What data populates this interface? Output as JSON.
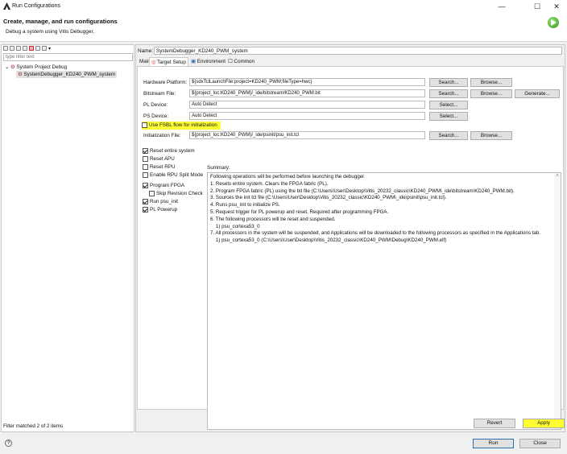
{
  "window": {
    "title": "Run Configurations",
    "minimize": "—",
    "maximize": "☐",
    "close": "✕"
  },
  "header": {
    "title": "Create, manage, and run configurations",
    "subtitle": "Debug a system using Vitis Debugger."
  },
  "left": {
    "filter_placeholder": "type filter text",
    "tree": [
      {
        "label": "System Project Debug"
      },
      {
        "label": "SystemDebugger_KD240_PWM_system"
      }
    ],
    "status": "Filter matched 2 of 2 items"
  },
  "right": {
    "name_label": "Name:",
    "name_value": "SystemDebugger_KD240_PWM_system",
    "tabs": [
      {
        "label": "Main"
      },
      {
        "label": "Target Setup"
      },
      {
        "label": "Environment"
      },
      {
        "label": "Common"
      }
    ],
    "fields": {
      "hardware_platform": {
        "label": "Hardware Platform:",
        "value": "${sdxTclLaunchFile:project=KD240_PWM;fileType=hwc}"
      },
      "bitstream": {
        "label": "Bitstream File:",
        "value": "${project_loc:KD240_PWM}/_ide/bitstream/KD240_PWM.bit"
      },
      "pl_device": {
        "label": "PL Device:",
        "value": "Auto Detect"
      },
      "ps_device": {
        "label": "PS Device:",
        "value": "Auto Detect"
      },
      "use_fsbl": {
        "label": "Use FSBL flow for initialization"
      },
      "init_file": {
        "label": "Initialization File:",
        "value": "${project_loc:KD240_PWM}/_ide/psinit/psu_init.tcl"
      }
    },
    "buttons": {
      "search": "Search...",
      "browse": "Browse...",
      "generate": "Generate...",
      "select": "Select..."
    },
    "options": [
      {
        "label": "Reset entire system",
        "checked": true
      },
      {
        "label": "Reset APU",
        "checked": false
      },
      {
        "label": "Reset RPU",
        "checked": false
      },
      {
        "label": "Enable RPU Split Mode",
        "checked": false
      },
      {
        "label": "Program FPGA",
        "checked": true
      },
      {
        "label": "Skip Revision Check",
        "checked": false
      },
      {
        "label": "Run psu_init",
        "checked": true
      },
      {
        "label": "PL Powerup",
        "checked": true
      }
    ],
    "summary_label": "Summary:",
    "summary_lines": [
      "Following operations will be performed before launching the debugger.",
      "1. Resets entire system. Clears the FPGA fabric (PL).",
      "2. Program FPGA fabric (PL) using the bit file (C:\\Users\\User\\Desktop\\Vitis_20232_classic\\KD240_PWM\\_ide\\bitstream\\KD240_PWM.bit).",
      "3. Sources the init tcl file (C:\\Users\\User\\Desktop\\Vitis_20232_classic\\KD240_PWM\\_ide\\psinit\\psu_init.tcl).",
      "4. Runs psu_init to initialize PS.",
      "5. Request trigger for PL powerup and reset. Required after programming FPGA.",
      "6. The following processors will be reset and suspended.",
      "    1) psu_cortexa53_0",
      "7. All processors in the system will be suspended, and Applications will be downloaded to the following processors as specified in the Applications tab.",
      "    1) psu_cortexa53_0 (C:\\Users\\User\\Desktop\\Vitis_20232_classic\\KD240_PWM\\Debug\\KD240_PWM.elf)"
    ],
    "revert": "Revert",
    "apply": "Apply"
  },
  "footer": {
    "help": "?",
    "run": "Run",
    "close": "Close"
  },
  "colors": {
    "highlight": "#ffff33",
    "run_badge": "#2f9a1c",
    "selection": "#e1e1e1"
  }
}
